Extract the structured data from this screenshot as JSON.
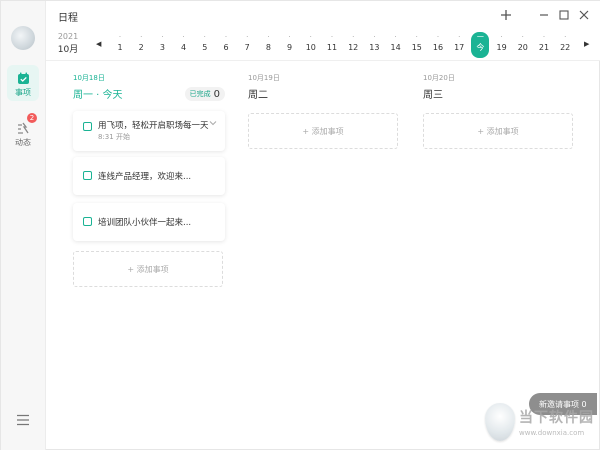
{
  "window": {
    "title": "日程"
  },
  "rail": {
    "items": [
      {
        "label": "事项",
        "active": true
      },
      {
        "label": "动态",
        "badge": "2"
      }
    ]
  },
  "datestrip": {
    "year": "2021",
    "month": "10月",
    "prev": "◀",
    "next": "▶",
    "days": [
      {
        "num": "1"
      },
      {
        "num": "2"
      },
      {
        "num": "3"
      },
      {
        "num": "4"
      },
      {
        "num": "5"
      },
      {
        "num": "6"
      },
      {
        "num": "7"
      },
      {
        "num": "8"
      },
      {
        "num": "9"
      },
      {
        "num": "10"
      },
      {
        "num": "11"
      },
      {
        "num": "12"
      },
      {
        "num": "13"
      },
      {
        "num": "14"
      },
      {
        "num": "15"
      },
      {
        "num": "16"
      },
      {
        "num": "17"
      },
      {
        "num": "今",
        "top": "一",
        "today": true
      },
      {
        "num": "19"
      },
      {
        "num": "20"
      },
      {
        "num": "21"
      },
      {
        "num": "22"
      }
    ]
  },
  "columns": [
    {
      "date": "10月18日",
      "head": "周一 · 今天",
      "done_label": "已完成",
      "done_count": "0",
      "cards": [
        {
          "title": "用飞项，轻松开启职场每一天",
          "sub": "8:31 开始"
        },
        {
          "title": "连线产品经理，欢迎来..."
        },
        {
          "title": "培训团队小伙伴一起来..."
        }
      ],
      "add_label": "+ 添加事项"
    },
    {
      "date": "10月19日",
      "head": "周二",
      "add_label": "+ 添加事项"
    },
    {
      "date": "10月20日",
      "head": "周三",
      "add_label": "+ 添加事项"
    }
  ],
  "bottom_pill": {
    "label": "新邀请事项 0"
  },
  "watermark": {
    "cn": "当下软件园",
    "url": "www.downxia.com"
  },
  "colors": {
    "accent": "#1ab394",
    "badge": "#f25b5b"
  }
}
